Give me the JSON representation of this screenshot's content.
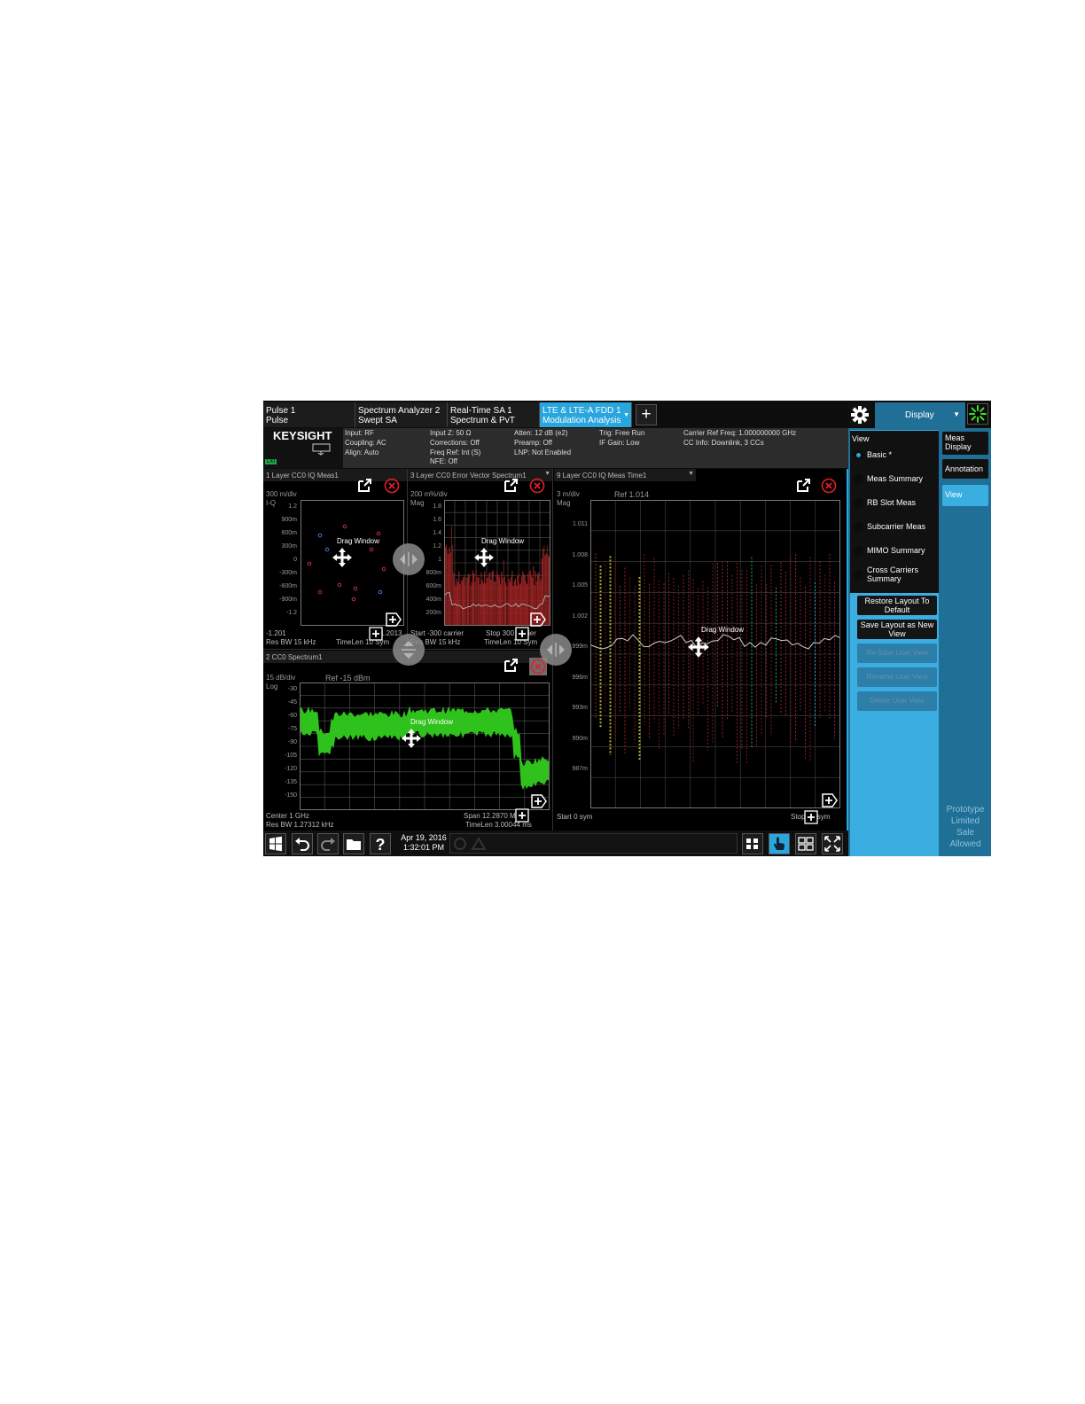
{
  "tabs": [
    {
      "line1": "Pulse 1",
      "line2": "Pulse"
    },
    {
      "line1": "Spectrum Analyzer 2",
      "line2": "Swept SA"
    },
    {
      "line1": "Real-Time SA 1",
      "line2": "Spectrum & PvT"
    },
    {
      "line1": "LTE & LTE-A FDD 1",
      "line2": "Modulation Analysis"
    }
  ],
  "add_tab": "+",
  "display_menu": {
    "label": "Display",
    "arrow": "▼"
  },
  "logo": "KEYSIGHT",
  "status_badge": "LXI",
  "settings": {
    "col1": [
      "Input: RF",
      "Coupling: AC",
      "Align: Auto"
    ],
    "col2": [
      "Input Z: 50 Ω",
      "Corrections: Off",
      "Freq Ref: Int (S)",
      "NFE: Off"
    ],
    "col3": [
      "Atten: 12 dB (e2)",
      "Preamp: Off",
      "LNP: Not Enabled"
    ],
    "col4": [
      "Trig: Free Run",
      "IF Gain: Low"
    ],
    "col5": [
      "Carrier Ref Freq: 1.000000000 GHz",
      "CC Info: Downlink, 3 CCs"
    ]
  },
  "windows": {
    "iq": {
      "title": "1 Layer CC0 IQ Meas1",
      "scale": "300 m/div",
      "axis": "I-Q",
      "ticks": [
        "1.2",
        "900m",
        "600m",
        "300m",
        "0",
        "-300m",
        "-600m",
        "-900m",
        "-1.2"
      ],
      "foot_left1": "-1.201",
      "foot_left2": "Res BW 15 kHz",
      "foot_mid1": "1.2013",
      "foot_mid2": "TimeLen 10  Sym",
      "drag": "Drag Window"
    },
    "evm": {
      "title": "3 Layer CC0 Error Vector Spectrum1",
      "scale": "200 m%/div",
      "axis": "Mag",
      "ticks": [
        "1.8",
        "1.6",
        "1.4",
        "1.2",
        "1",
        "800m",
        "600m",
        "400m",
        "200m"
      ],
      "foot_left1": "Start -300  carrier",
      "foot_left2": "Res BW 15 kHz",
      "foot_right1": "Stop 300  carrier",
      "foot_right2": "TimeLen 10  Sym",
      "drag": "Drag Window"
    },
    "spectrum": {
      "title": "2 CC0 Spectrum1",
      "scale": "15 dB/div",
      "ref": "Ref -15 dBm",
      "axis": "Log",
      "ticks": [
        "-30",
        "-45",
        "-60",
        "-75",
        "-90",
        "-105",
        "-120",
        "-135",
        "-150"
      ],
      "foot_left1": "Center 1 GHz",
      "foot_left2": "Res BW 1.27312 kHz",
      "foot_right1": "Span 12.2870  MHz",
      "foot_right2": "TimeLen 3.00044 ms",
      "drag": "Drag Window"
    },
    "time": {
      "title": "9 Layer CC0 IQ Meas Time1",
      "scale": "3 m/div",
      "ref": "Ref 1.014",
      "axis": "Mag",
      "ticks": [
        "1.011",
        "1.008",
        "1.005",
        "1.002",
        "999m",
        "996m",
        "993m",
        "990m",
        "987m"
      ],
      "foot_left": "Start 0  sym",
      "foot_right": "Stop 10  sym",
      "drag": "Drag Window"
    }
  },
  "panel": {
    "view_header": "View",
    "radios": [
      {
        "label": "Basic *",
        "selected": true
      },
      {
        "label": "Meas Summary",
        "selected": false
      },
      {
        "label": "RB Slot Meas",
        "selected": false
      },
      {
        "label": "Subcarrier Meas",
        "selected": false
      },
      {
        "label": "MIMO Summary",
        "selected": false
      },
      {
        "label": "Cross Carriers Summary",
        "selected": false
      }
    ],
    "buttons": [
      {
        "label": "Restore Layout To Default",
        "enabled": true
      },
      {
        "label": "Save Layout as New View",
        "enabled": true
      },
      {
        "label": "Re-Save User View",
        "enabled": false
      },
      {
        "label": "Rename User View",
        "enabled": false
      },
      {
        "label": "Delete User View",
        "enabled": false
      }
    ],
    "right_tabs": [
      "Meas Display",
      "Annotation",
      "View"
    ],
    "active_right_tab": "View",
    "watermark": [
      "Prototype",
      "Limited",
      "Sale",
      "Allowed"
    ]
  },
  "taskbar": {
    "date": "Apr 19, 2016",
    "time": "1:32:01 PM"
  },
  "colors": {
    "accent": "#2aa6de",
    "panel": "#1f6f96",
    "trace_green": "#2fc21c",
    "close_red": "#e0202a"
  }
}
